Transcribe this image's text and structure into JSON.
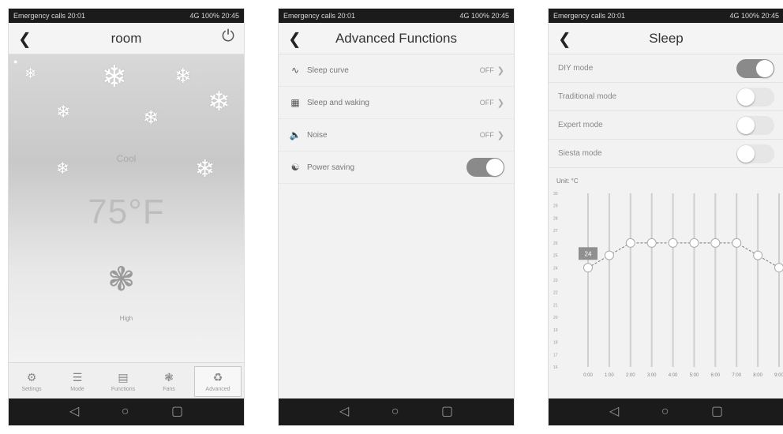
{
  "screens": {
    "room": {
      "status_left": "Emergency calls  20:01",
      "status_right": "4G  100%  20:45",
      "title": "room",
      "mode": "Cool",
      "temperature": "75°F",
      "fan_label": "High",
      "tabs": [
        {
          "label": "Settings",
          "icon": "gear-icon"
        },
        {
          "label": "Mode",
          "icon": "list-icon"
        },
        {
          "label": "Functions",
          "icon": "calendar-icon"
        },
        {
          "label": "Fans",
          "icon": "fan-icon"
        },
        {
          "label": "Advanced",
          "icon": "advanced-icon"
        }
      ]
    },
    "advanced": {
      "status_left": "Emergency calls  20:01",
      "status_right": "4G  100%  20:45",
      "title": "Advanced Functions",
      "rows": [
        {
          "label": "Sleep curve",
          "value": "OFF",
          "icon": "curve-icon"
        },
        {
          "label": "Sleep and waking",
          "value": "OFF",
          "icon": "grid-icon"
        },
        {
          "label": "Noise",
          "value": "OFF",
          "icon": "speaker-icon"
        },
        {
          "label": "Power saving",
          "value": "on",
          "icon": "leaf-icon"
        }
      ]
    },
    "sleep": {
      "status_left": "Emergency calls  20:01",
      "status_right": "4G  100%  20:45",
      "title": "Sleep",
      "modes": [
        {
          "label": "DIY mode",
          "state": "on"
        },
        {
          "label": "Traditional mode",
          "state": "off"
        },
        {
          "label": "Expert mode",
          "state": "off"
        },
        {
          "label": "Siesta mode",
          "state": "off"
        }
      ],
      "unit": "Unit: °C"
    }
  },
  "chart_data": {
    "type": "line",
    "x": [
      "0:00",
      "1:00",
      "2:00",
      "3:00",
      "4:00",
      "5:00",
      "6:00",
      "7:00",
      "8:00",
      "9:00"
    ],
    "values": [
      24,
      25,
      26,
      26,
      26,
      26,
      26,
      26,
      25,
      24
    ],
    "ylim": [
      16,
      30
    ],
    "selected_label": "24",
    "grid": true
  },
  "colors": {
    "toggle_on": "#8a8a8a",
    "toggle_off": "#e6e6e6",
    "background": "#f2f2f2"
  }
}
